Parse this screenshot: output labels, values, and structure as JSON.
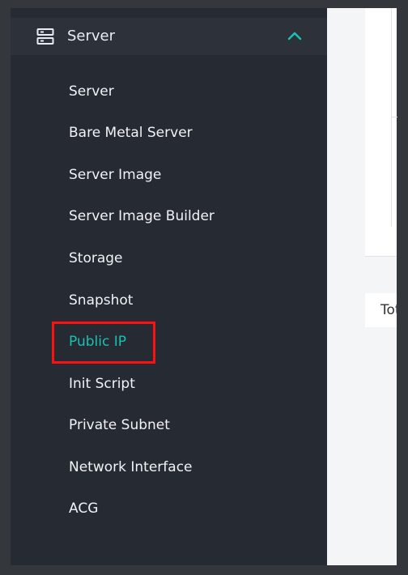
{
  "sidebar": {
    "header": {
      "label": "Server",
      "icon": "server-icon",
      "expanded_icon": "chevron-up-icon"
    },
    "items": [
      {
        "label": "Server"
      },
      {
        "label": "Bare Metal Server"
      },
      {
        "label": "Server Image"
      },
      {
        "label": "Server Image Builder"
      },
      {
        "label": "Storage"
      },
      {
        "label": "Snapshot"
      },
      {
        "label": "Public IP",
        "active": true
      },
      {
        "label": "Init Script"
      },
      {
        "label": "Private Subnet"
      },
      {
        "label": "Network Interface"
      },
      {
        "label": "ACG"
      }
    ]
  },
  "content": {
    "total_text": "Total"
  },
  "colors": {
    "background": "#34383d",
    "sidebar": "#262a33",
    "header": "#2c313a",
    "text": "#f1f3f6",
    "active": "#1ac1b1",
    "highlight": "#ff1010",
    "content": "#f4f5f7"
  }
}
